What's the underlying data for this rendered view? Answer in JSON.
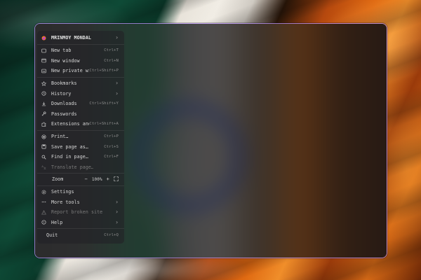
{
  "profile": {
    "name": "MRINMOY MONDAL"
  },
  "menu": {
    "new_tab": {
      "label": "New tab",
      "shortcut": "Ctrl+T"
    },
    "new_window": {
      "label": "New window",
      "shortcut": "Ctrl+N"
    },
    "new_private": {
      "label": "New private win…",
      "shortcut": "Ctrl+Shift+P"
    },
    "bookmarks": {
      "label": "Bookmarks"
    },
    "history": {
      "label": "History"
    },
    "downloads": {
      "label": "Downloads",
      "shortcut": "Ctrl+Shift+Y"
    },
    "passwords": {
      "label": "Passwords"
    },
    "extensions": {
      "label": "Extensions and …",
      "shortcut": "Ctrl+Shift+A"
    },
    "print": {
      "label": "Print…",
      "shortcut": "Ctrl+P"
    },
    "save_page": {
      "label": "Save page as…",
      "shortcut": "Ctrl+S"
    },
    "find": {
      "label": "Find in page…",
      "shortcut": "Ctrl+F"
    },
    "translate": {
      "label": "Translate page…"
    },
    "zoom": {
      "label": "Zoom",
      "minus": "−",
      "value": "100%",
      "plus": "+"
    },
    "settings": {
      "label": "Settings"
    },
    "more_tools": {
      "label": "More tools"
    },
    "report": {
      "label": "Report broken site"
    },
    "help": {
      "label": "Help"
    },
    "quit": {
      "label": "Quit",
      "shortcut": "Ctrl+Q"
    }
  },
  "colors": {
    "panel_border": "#be96ff",
    "menu_bg": "#222226"
  }
}
